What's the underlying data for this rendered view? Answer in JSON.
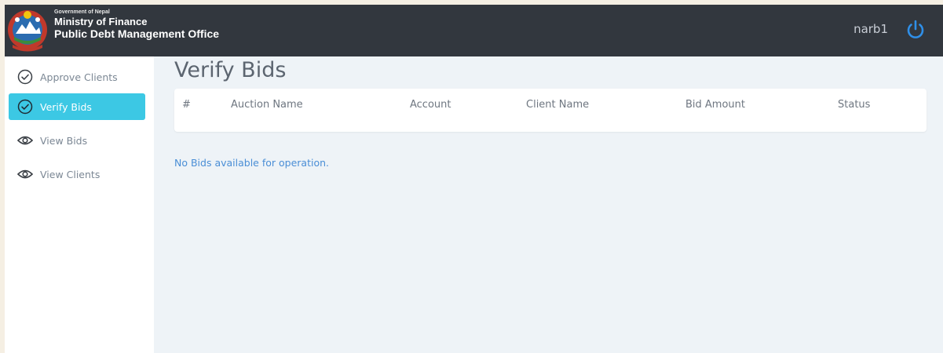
{
  "header": {
    "org_line1": "Government of Nepal",
    "org_line2": "Ministry of Finance",
    "org_line3": "Public Debt Management Office",
    "username": "narb1"
  },
  "sidebar": {
    "items": [
      {
        "label": "Approve Clients",
        "icon": "check-circle-icon"
      },
      {
        "label": "Verify Bids",
        "icon": "check-circle-icon"
      },
      {
        "label": "View Bids",
        "icon": "eye-icon"
      },
      {
        "label": "View Clients",
        "icon": "eye-icon"
      }
    ]
  },
  "main": {
    "title": "Verify Bids",
    "table": {
      "columns": [
        "#",
        "Auction Name",
        "Account",
        "Client Name",
        "Bid Amount",
        "Status"
      ]
    },
    "empty_message": "No Bids available for operation."
  },
  "colors": {
    "header_bg": "#32373e",
    "accent": "#3cc8e4",
    "power_icon": "#2f8fe8",
    "link": "#4a8ed6"
  }
}
